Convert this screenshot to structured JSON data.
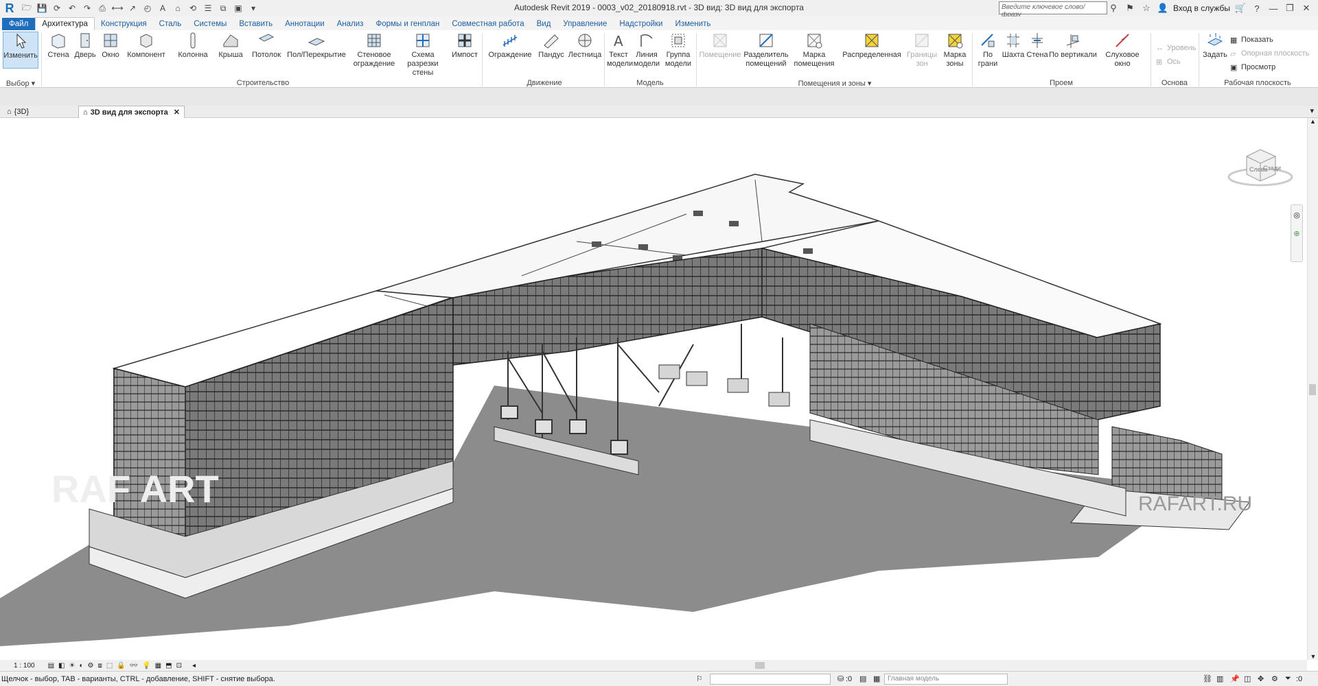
{
  "window": {
    "title": "Autodesk Revit 2019 - 0003_v02_20180918.rvt - 3D вид: 3D вид для экспорта"
  },
  "search": {
    "placeholder": "Введите ключевое слово/фразу"
  },
  "signin": {
    "label": "Вход в службы"
  },
  "menu": {
    "tabs": [
      "Файл",
      "Архитектура",
      "Конструкция",
      "Сталь",
      "Системы",
      "Вставить",
      "Аннотации",
      "Анализ",
      "Формы и генплан",
      "Совместная работа",
      "Вид",
      "Управление",
      "Надстройки",
      "Изменить"
    ]
  },
  "ribbon": {
    "select": {
      "modify": "Изменить",
      "panel": "Выбор"
    },
    "build": {
      "wall": "Стена",
      "door": "Дверь",
      "window": "Окно",
      "component": "Компонент",
      "column": "Колонна",
      "roof": "Крыша",
      "ceiling": "Потолок",
      "floor": "Пол/Перекрытие",
      "curtain_system_1": "Стеновое",
      "curtain_system_2": "ограждение",
      "curtain_grid_1": "Схема разрезки",
      "curtain_grid_2": "стены",
      "mullion": "Импост",
      "panel": "Строительство"
    },
    "circulation": {
      "railing": "Ограждение",
      "ramp": "Пандус",
      "stair": "Лестница",
      "panel": "Движение"
    },
    "model": {
      "text_1": "Текст",
      "text_2": "модели",
      "line_1": "Линия",
      "line_2": "модели",
      "group_1": "Группа",
      "group_2": "модели",
      "panel": "Модель"
    },
    "room": {
      "room": "Помещение",
      "separator_1": "Разделитель",
      "separator_2": "помещений",
      "tag_1": "Марка",
      "tag_2": "помещения",
      "area": "Распределенная",
      "boundary_1": "Границы",
      "boundary_2": "зон",
      "area_tag_1": "Марка",
      "area_tag_2": "зоны",
      "panel": "Помещения и зоны"
    },
    "opening": {
      "face_1": "По",
      "face_2": "грани",
      "shaft": "Шахта",
      "wall": "Стена",
      "vertical": "По вертикали",
      "dormer": "Слуховое окно",
      "panel": "Проем"
    },
    "datum": {
      "level": "Уровень",
      "grid": "Ось",
      "panel": "Основа"
    },
    "workplane": {
      "set": "Задать",
      "show": "Показать",
      "ref_plane": "Опорная плоскость",
      "viewer": "Просмотр",
      "panel": "Рабочая плоскость"
    }
  },
  "views": {
    "tab1": "{3D}",
    "tab2": "3D вид для экспорта"
  },
  "viewcube": {
    "face1": "Слева",
    "face2": "Сзади"
  },
  "watermarks": {
    "left": "RAF ART",
    "right": "RAFART.RU"
  },
  "viewbar": {
    "scale": "1 : 100"
  },
  "status": {
    "hint": "Щелчок - выбор, TAB - варианты, CTRL - добавление, SHIFT - снятие выбора.",
    "zero": ":0",
    "model": "Главная модель"
  },
  "colors": {
    "file_tab": "#1f6ebe",
    "accent": "#1c5ea0",
    "shadow": "#8c8c8c",
    "structure": "#3a3a3a"
  }
}
